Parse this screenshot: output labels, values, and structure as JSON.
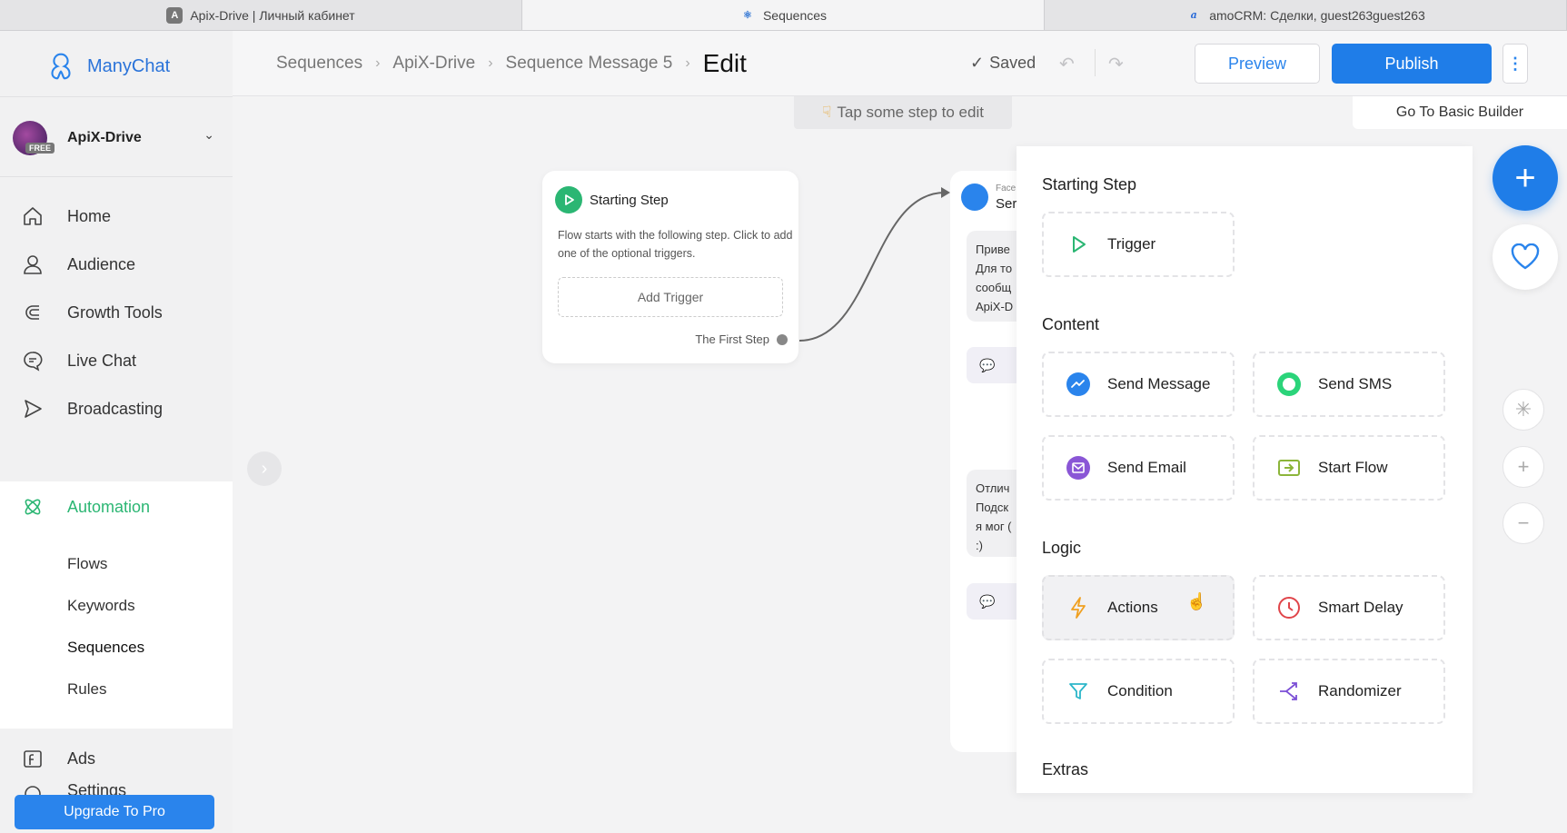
{
  "browser_tabs": [
    {
      "label": "Apix-Drive | Личный кабинет",
      "icon": "letter-a-icon"
    },
    {
      "label": "Sequences",
      "icon": "manychat-icon"
    },
    {
      "label": "amoCRM: Сделки, guest263guest263",
      "icon": "amocrm-icon"
    }
  ],
  "brand": {
    "name": "ManyChat",
    "accent": "#2a84ec",
    "green": "#2bb673"
  },
  "account": {
    "name": "ApiX-Drive",
    "badge": "FREE"
  },
  "nav": {
    "home": "Home",
    "audience": "Audience",
    "growth_tools": "Growth Tools",
    "live_chat": "Live Chat",
    "broadcasting": "Broadcasting",
    "automation": "Automation",
    "ads": "Ads",
    "settings": "Settings"
  },
  "automation_sub": [
    "Flows",
    "Keywords",
    "Sequences",
    "Rules"
  ],
  "upgrade_label": "Upgrade To Pro",
  "breadcrumb": [
    "Sequences",
    "ApiX-Drive",
    "Sequence Message 5",
    "Edit"
  ],
  "header": {
    "saved": "Saved",
    "preview": "Preview",
    "publish": "Publish"
  },
  "canvas": {
    "hint": "Tap some step to edit",
    "basic_builder": "Go To Basic Builder",
    "start_card": {
      "title": "Starting Step",
      "desc": "Flow starts with the following step. Click to add one of the optional triggers.",
      "add_trigger": "Add Trigger",
      "first_step": "The First Step"
    },
    "msg_card": {
      "source": "Face",
      "title": "Ser",
      "bubble1": [
        "Приве",
        "Для то",
        "сообщ",
        "ApiX-D"
      ],
      "bubble2": [
        "Отлич",
        "Подск",
        "я мог (",
        ":)"
      ]
    }
  },
  "panel": {
    "starting_step": "Starting Step",
    "trigger": "Trigger",
    "content": "Content",
    "send_message": "Send Message",
    "send_sms": "Send SMS",
    "send_email": "Send Email",
    "start_flow": "Start Flow",
    "logic": "Logic",
    "actions": "Actions",
    "smart_delay": "Smart Delay",
    "condition": "Condition",
    "randomizer": "Randomizer",
    "extras": "Extras"
  }
}
